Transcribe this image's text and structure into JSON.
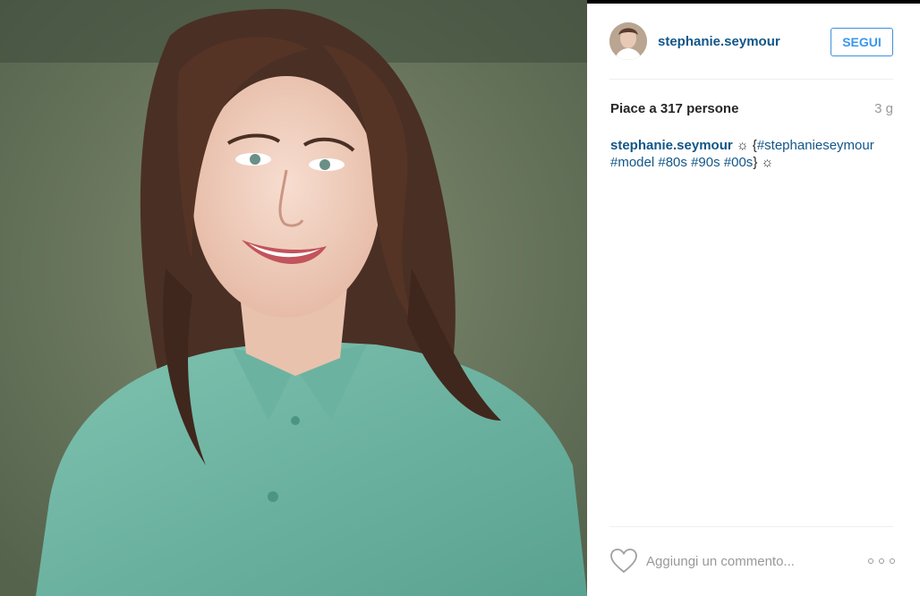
{
  "post": {
    "image_alt": "Photo of a smiling woman with long brown hair wearing a teal shirt",
    "author": {
      "username": "stephanie.seymour",
      "follow_label": "SEGUI"
    },
    "likes_text": "Piace a 317 persone",
    "age_text": "3 g",
    "caption": {
      "username": "stephanie.seymour",
      "prefix": " ☼ {",
      "hashtags": [
        "#stephanieseymour",
        "#model",
        "#80s",
        "#90s",
        "#00s"
      ],
      "suffix": "} ☼"
    },
    "comment": {
      "placeholder": "Aggiungi un commento...",
      "value": ""
    }
  },
  "icons": {
    "like": "heart-icon",
    "more": "more-options-icon"
  },
  "colors": {
    "link": "#125688",
    "follow": "#3897f0",
    "muted": "#999999"
  }
}
